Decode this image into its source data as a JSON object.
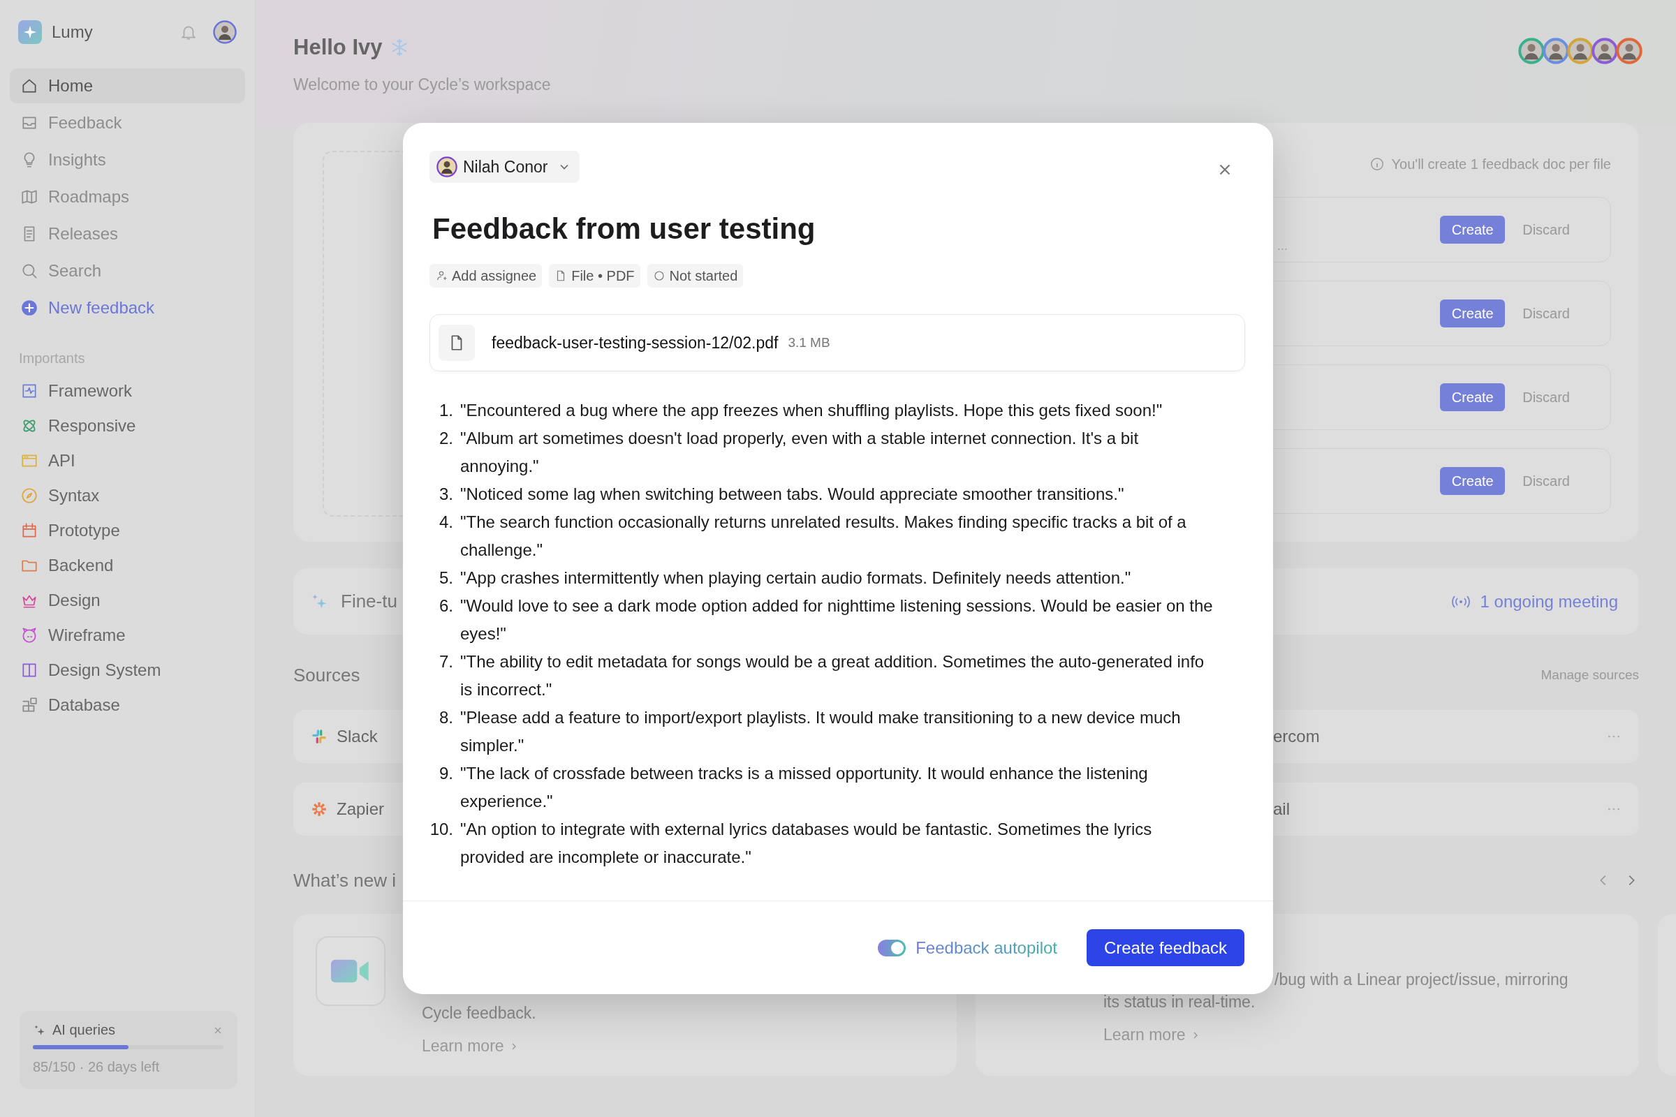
{
  "sidebar": {
    "brand": "Lumy",
    "nav": [
      {
        "label": "Home",
        "selected": true
      },
      {
        "label": "Feedback",
        "selected": false
      },
      {
        "label": "Insights",
        "selected": false
      },
      {
        "label": "Roadmaps",
        "selected": false
      },
      {
        "label": "Releases",
        "selected": false
      },
      {
        "label": "Search",
        "selected": false
      }
    ],
    "new_feedback": "New feedback",
    "section_title": "Importants",
    "importants": [
      {
        "label": "Framework",
        "color": "#6b7fd6"
      },
      {
        "label": "Responsive",
        "color": "#3d9a6b"
      },
      {
        "label": "API",
        "color": "#d9b338"
      },
      {
        "label": "Syntax",
        "color": "#e0a43a"
      },
      {
        "label": "Prototype",
        "color": "#e0664a"
      },
      {
        "label": "Backend",
        "color": "#e07a4a"
      },
      {
        "label": "Design",
        "color": "#d9479a"
      },
      {
        "label": "Wireframe",
        "color": "#c34fd0"
      },
      {
        "label": "Design System",
        "color": "#8b5cd6"
      },
      {
        "label": "Database",
        "color": "#8a8a8a"
      }
    ],
    "ai_card": {
      "title": "AI queries",
      "level": 0.5,
      "usage": "85/150 · 26 days left"
    }
  },
  "header": {
    "greeting": "Hello Ivy",
    "subtitle": "Welcome to your Cycle’s workspace",
    "avatars": [
      {
        "color": "#3bb08f"
      },
      {
        "color": "#6a8fe0"
      },
      {
        "color": "#d4a53a"
      },
      {
        "color": "#8b5cd6"
      },
      {
        "color": "#e0663b"
      }
    ]
  },
  "import_panel": {
    "note": "You'll create 1 feedback doc per file",
    "rows": [
      {
        "text": "...",
        "create": "Create",
        "discard": "Discard"
      },
      {
        "create": "Create",
        "discard": "Discard"
      },
      {
        "create": "Create",
        "discard": "Discard"
      },
      {
        "create": "Create",
        "discard": "Discard"
      }
    ]
  },
  "meeting_bar": {
    "label": "Fine-tu",
    "meeting": "1 ongoing meeting"
  },
  "sources": {
    "title": "Sources",
    "manage": "Manage sources",
    "left": [
      "Slack",
      "Zapier"
    ],
    "right": [
      "ercom",
      "ail"
    ]
  },
  "whats_new": {
    "title": "What’s new i",
    "left_card": {
      "text": "Cycle feedback.",
      "link": "Learn more"
    },
    "right_card": {
      "lead": "/bug with a Linear project/issue, mirroring",
      "text": "its status in real-time.",
      "link": "Learn more"
    }
  },
  "modal": {
    "author": "Nilah Conor",
    "title": "Feedback from user testing",
    "chips": [
      "Add assignee",
      "File • PDF",
      "Not started"
    ],
    "file": {
      "name": "feedback-user-testing-session-12/02.pdf",
      "size": "3.1 MB"
    },
    "items": [
      {
        "number": "1.",
        "text": "\"Encountered a bug where the app freezes when shuffling playlists. Hope this gets fixed soon!\""
      },
      {
        "number": "2.",
        "text": "\"Album art sometimes doesn't load properly, even with a stable internet connection. It's a bit annoying.\""
      },
      {
        "number": "3.",
        "text": "\"Noticed some lag when switching between tabs. Would appreciate smoother transitions.\""
      },
      {
        "number": "4.",
        "text": "\"The search function occasionally returns unrelated results. Makes finding specific tracks a bit of a challenge.\""
      },
      {
        "number": "5.",
        "text": "\"App crashes intermittently when playing certain audio formats. Definitely needs attention.\""
      },
      {
        "number": "6.",
        "text": "\"Would love to see a dark mode option added for nighttime listening sessions. Would be easier on the eyes!\""
      },
      {
        "number": "7.",
        "text": "\"The ability to edit metadata for songs would be a great addition. Sometimes the auto-generated info is incorrect.\""
      },
      {
        "number": "8.",
        "text": "\"Please add a feature to import/export playlists. It would make transitioning to a new device much simpler.\""
      },
      {
        "number": "9.",
        "text": "\"The lack of crossfade between tracks is a missed opportunity. It would enhance the listening experience.\""
      },
      {
        "number": "10.",
        "text": "\"An option to integrate with external lyrics databases would be fantastic. Sometimes the lyrics provided are incomplete or inaccurate.\""
      }
    ],
    "autopilot": {
      "label": "Feedback autopilot",
      "on": true
    },
    "submit": "Create feedback"
  }
}
